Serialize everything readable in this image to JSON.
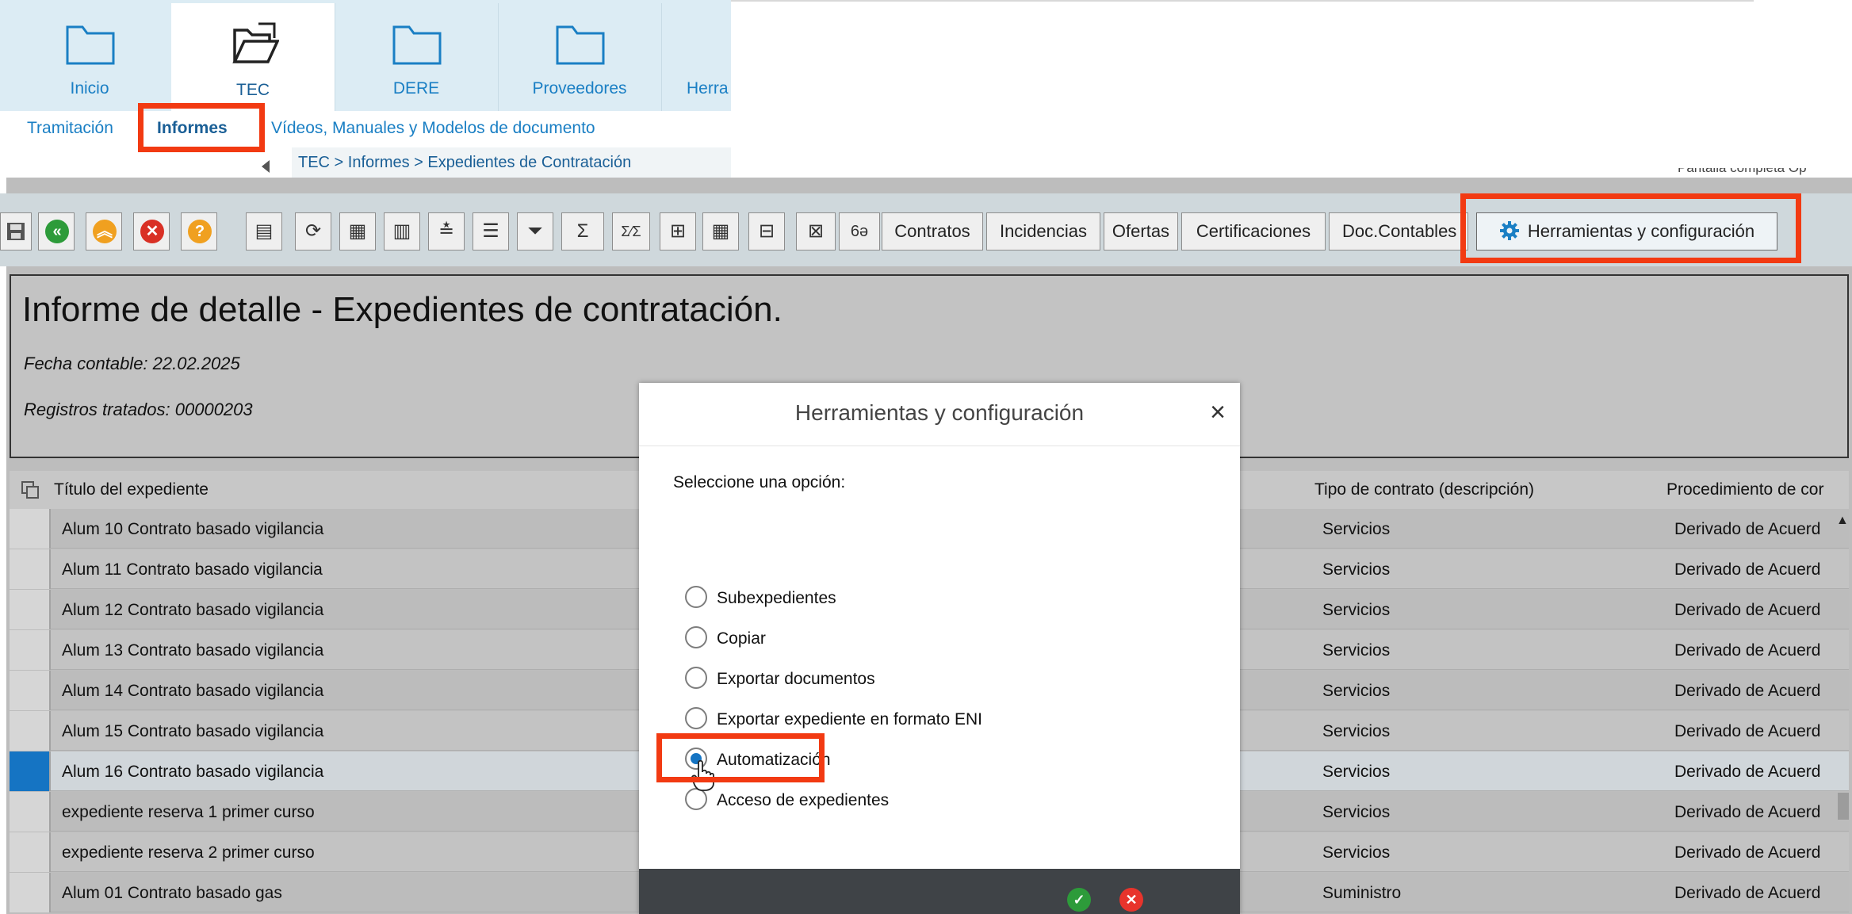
{
  "nav": {
    "tabs": [
      {
        "label": "Inicio"
      },
      {
        "label": "TEC"
      },
      {
        "label": "DERE"
      },
      {
        "label": "Proveedores"
      },
      {
        "label": "Herra"
      }
    ],
    "subnav": [
      "Tramitación",
      "Informes",
      "Vídeos, Manuales y Modelos de documento"
    ],
    "breadcrumb": "TEC  >  Informes  >  Expedientes de Contratación",
    "right_text": "Pantalla completa   Op"
  },
  "toolbar": {
    "labeled_buttons": [
      "Contratos",
      "Incidencias",
      "Ofertas",
      "Certificaciones",
      "Doc.Contables"
    ],
    "tools_button": "Herramientas y configuración",
    "glyphs": {
      "sigma": "Σ",
      "fraction": "Σ⁄Σ",
      "glasses": "6ə"
    },
    "colors": {
      "green": "#2d9b3a",
      "orange": "#f0a020",
      "red": "#d93025",
      "help": "#f0a020"
    }
  },
  "report": {
    "title": "Informe de detalle - Expedientes de contratación.",
    "fecha": "Fecha contable: 22.02.2025",
    "registros": "Registros tratados: 00000203"
  },
  "table": {
    "columns": [
      "Título del expediente",
      "Tipo de contrato (descripción)",
      "Procedimiento de cor"
    ],
    "rows": [
      {
        "title": "Alum 10 Contrato basado vigilancia",
        "tipo": "Servicios",
        "proc": "Derivado de Acuerd",
        "selected": false
      },
      {
        "title": "Alum 11 Contrato basado vigilancia",
        "tipo": "Servicios",
        "proc": "Derivado de Acuerd",
        "selected": false
      },
      {
        "title": "Alum 12 Contrato basado vigilancia",
        "tipo": "Servicios",
        "proc": "Derivado de Acuerd",
        "selected": false
      },
      {
        "title": "Alum 13 Contrato basado vigilancia",
        "tipo": "Servicios",
        "proc": "Derivado de Acuerd",
        "selected": false
      },
      {
        "title": "Alum 14 Contrato basado vigilancia",
        "tipo": "Servicios",
        "proc": "Derivado de Acuerd",
        "selected": false
      },
      {
        "title": "Alum 15 Contrato basado vigilancia",
        "tipo": "Servicios",
        "proc": "Derivado de Acuerd",
        "selected": false
      },
      {
        "title": "Alum 16 Contrato basado vigilancia",
        "tipo": "Servicios",
        "proc": "Derivado de Acuerd",
        "selected": true
      },
      {
        "title": "expediente reserva 1 primer curso",
        "tipo": "Servicios",
        "proc": "Derivado de Acuerd",
        "selected": false
      },
      {
        "title": "expediente reserva 2 primer curso",
        "tipo": "Servicios",
        "proc": "Derivado de Acuerd",
        "selected": false
      },
      {
        "title": "Alum 01 Contrato basado gas",
        "tipo": "Suministro",
        "proc": "Derivado de Acuerd",
        "selected": false
      }
    ]
  },
  "modal": {
    "title": "Herramientas y configuración",
    "close": "×",
    "prompt": "Seleccione una opción:",
    "options": [
      {
        "label": "Subexpedientes",
        "checked": false
      },
      {
        "label": "Copiar",
        "checked": false
      },
      {
        "label": "Exportar documentos",
        "checked": false
      },
      {
        "label": "Exportar expediente en formato ENI",
        "checked": false
      },
      {
        "label": "Automatización",
        "checked": true
      },
      {
        "label": "Acceso de expedientes",
        "checked": false
      }
    ],
    "ok": "✓",
    "cancel": "✕"
  },
  "colors": {
    "highlight": "#f23a12",
    "link": "#1a7fc4",
    "selection": "#1574c3"
  }
}
